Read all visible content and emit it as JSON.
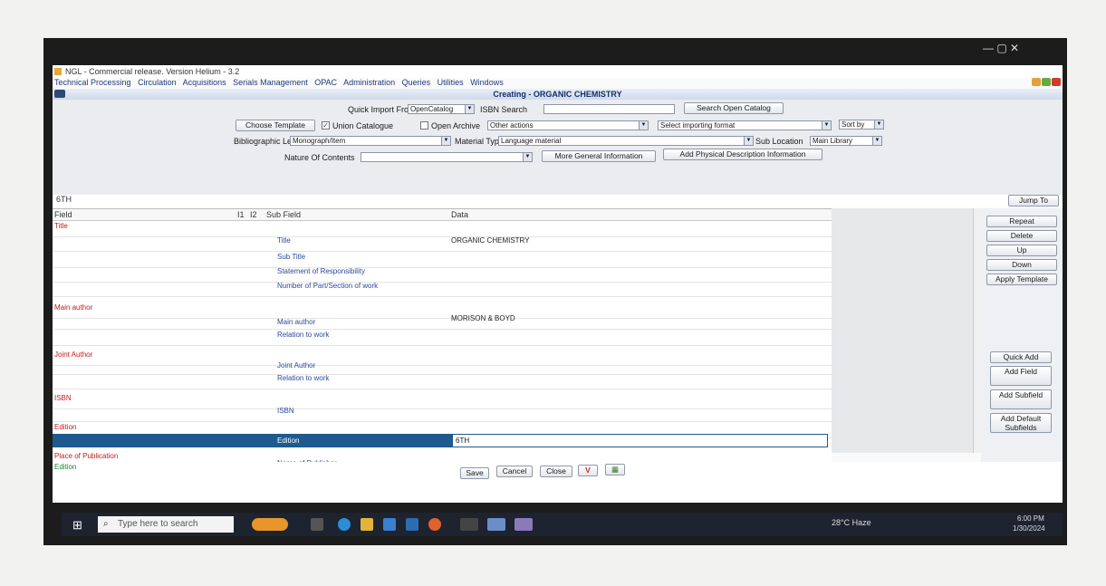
{
  "window": {
    "title": "NGL - Commercial release. Version Helium - 3.2",
    "header": "Creating - ORGANIC CHEMISTRY",
    "controls": "—   ▢   ✕"
  },
  "menu": [
    "Technical Processing",
    "Circulation",
    "Acquisitions",
    "Serials Management",
    "OPAC",
    "Administration",
    "Queries",
    "Utilities",
    "Windows"
  ],
  "form": {
    "quick_import_label": "Quick Import From",
    "quick_import_value": "OpenCatalog",
    "isbn_search_label": "ISBN Search",
    "isbn_search_value": "",
    "search_open_catalog": "Search Open Catalog",
    "choose_template": "Choose Template",
    "union_catalogue": "Union Catalogue",
    "open_archive": "Open Archive",
    "other_actions": "Other actions",
    "importing_format": "Select importing format",
    "sort_by": "Sort by",
    "bib_level_label": "Bibliographic Level",
    "bib_level_value": "Monograph/Item",
    "material_type_label": "Material Type",
    "material_type_value": "Language material",
    "sub_location_label": "Sub Location",
    "sub_location_value": "Main Library",
    "nature_label": "Nature Of Contents",
    "nature_value": "",
    "more_general": "More General Information",
    "add_physical": "Add Physical Description Information"
  },
  "search_value": "6TH",
  "jump_to": "Jump To",
  "grid": {
    "headers": {
      "field": "Field",
      "i1": "I1",
      "i2": "I2",
      "subfield": "Sub Field",
      "data": "Data"
    },
    "rows": [
      {
        "field": "Title",
        "subfield": "",
        "data": ""
      },
      {
        "field": "",
        "subfield": "Title",
        "data": "ORGANIC CHEMISTRY"
      },
      {
        "field": "",
        "subfield": "Sub Title",
        "data": ""
      },
      {
        "field": "",
        "subfield": "Statement of Responsibility",
        "data": ""
      },
      {
        "field": "",
        "subfield": "Number of Part/Section of work",
        "data": ""
      },
      {
        "field": "Main author",
        "subfield": "",
        "data": ""
      },
      {
        "field": "",
        "subfield": "Main author",
        "data": "MORISON & BOYD"
      },
      {
        "field": "",
        "subfield": "Relation to work",
        "data": ""
      },
      {
        "field": "Joint Author",
        "subfield": "",
        "data": ""
      },
      {
        "field": "",
        "subfield": "Joint Author",
        "data": ""
      },
      {
        "field": "",
        "subfield": "Relation to work",
        "data": ""
      },
      {
        "field": "ISBN",
        "subfield": "",
        "data": ""
      },
      {
        "field": "",
        "subfield": "ISBN",
        "data": ""
      },
      {
        "field": "Edition",
        "subfield": "",
        "data": ""
      }
    ],
    "selected": {
      "subfield": "Edition",
      "data": "6TH"
    },
    "after": [
      {
        "field": "Place of Publication",
        "subfield": "Name of Publisher"
      }
    ]
  },
  "side_buttons": [
    "Repeat",
    "Delete",
    "Up",
    "Down",
    "Apply Template"
  ],
  "side_buttons2": [
    "Quick Add",
    "Add Field",
    "Add Subfield",
    "Add Default Subfields"
  ],
  "bottom_field": "Edition",
  "bottom_buttons": {
    "save": "Save",
    "cancel": "Cancel",
    "close": "Close"
  },
  "taskbar": {
    "search_placeholder": "Type here to search",
    "weather": "28°C  Haze",
    "time": "6:00 PM",
    "date": "1/30/2024"
  },
  "colors": {
    "accent": "#1e5a8e",
    "field_red": "#c21b1b",
    "subfield_blue": "#2a4a9a"
  }
}
